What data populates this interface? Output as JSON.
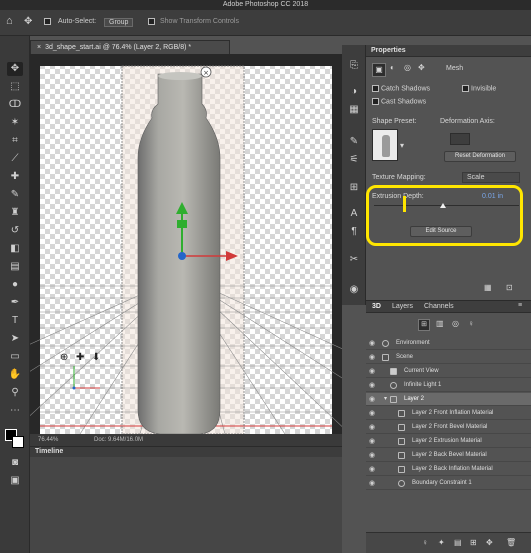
{
  "app": {
    "title": "Adobe Photoshop CC 2018"
  },
  "options_bar": {
    "auto_select_label": "Auto-Select:",
    "auto_select_value": "Group",
    "transform_controls_label": "Show Transform Controls"
  },
  "document": {
    "tab_title": "3d_shape_start.ai @ 76.4% (Layer 2, RGB/8) *",
    "zoom_readout": "76.44%",
    "doc_size": "Doc: 9.64M/16.0M"
  },
  "timeline": {
    "title": "Timeline"
  },
  "properties": {
    "title": "Properties",
    "mode_label": "Mesh",
    "catch_shadows_label": "Catch Shadows",
    "invisible_label": "Invisible",
    "cast_shadows_label": "Cast Shadows",
    "shape_preset_label": "Shape Preset:",
    "deformation_axis_label": "Deformation Axis:",
    "reset_deformation_label": "Reset Deformation",
    "texture_mapping_label": "Texture Mapping:",
    "texture_mapping_value": "Scale",
    "extrusion_depth_label": "Extrusion Depth:",
    "extrusion_depth_value": "0.01 in",
    "edit_source_label": "Edit Source"
  },
  "layers_panel": {
    "tabs": [
      "3D",
      "Layers",
      "Channels"
    ],
    "items": [
      {
        "label": "Environment",
        "icon": "globe-icon"
      },
      {
        "label": "Scene",
        "icon": "scene-icon"
      },
      {
        "label": "Current View",
        "icon": "camera-icon"
      },
      {
        "label": "Infinite Light 1",
        "icon": "light-icon"
      },
      {
        "label": "Layer 2",
        "icon": "mesh-icon"
      },
      {
        "label": "Layer 2 Front Inflation Material",
        "icon": "material-icon"
      },
      {
        "label": "Layer 2 Front Bevel Material",
        "icon": "material-icon"
      },
      {
        "label": "Layer 2 Extrusion Material",
        "icon": "material-icon"
      },
      {
        "label": "Layer 2 Back Bevel Material",
        "icon": "material-icon"
      },
      {
        "label": "Layer 2 Back Inflation Material",
        "icon": "material-icon"
      },
      {
        "label": "Boundary Constraint 1",
        "icon": "constraint-icon"
      }
    ]
  },
  "colors": {
    "highlight": "#ffe600",
    "accent": "#4a7fd0",
    "selected_row": "#6a6a6a"
  }
}
